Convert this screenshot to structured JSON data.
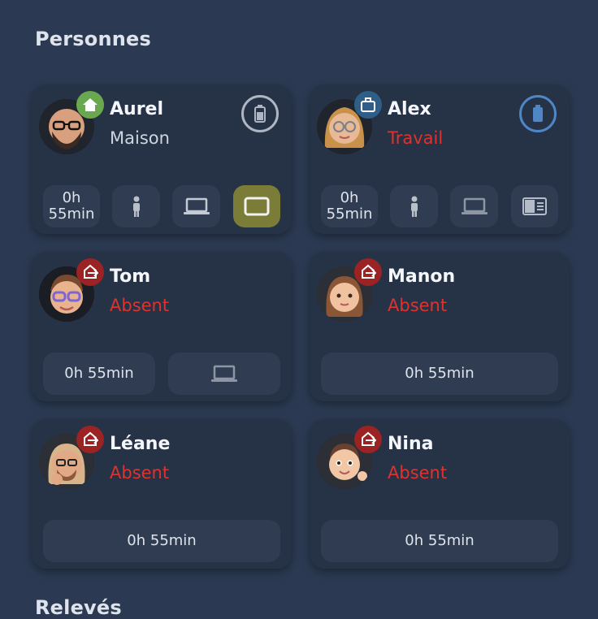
{
  "sections": {
    "people_title": "Personnes",
    "readings_title": "Relevés"
  },
  "people": [
    {
      "name": "Aurel",
      "status": "Maison",
      "status_type": "home",
      "duration_line1": "0h",
      "duration_line2": "55min"
    },
    {
      "name": "Alex",
      "status": "Travail",
      "status_type": "work",
      "duration_line1": "0h",
      "duration_line2": "55min"
    },
    {
      "name": "Tom",
      "status": "Absent",
      "status_type": "absent",
      "duration": "0h 55min"
    },
    {
      "name": "Manon",
      "status": "Absent",
      "status_type": "absent",
      "duration": "0h 55min"
    },
    {
      "name": "Léane",
      "status": "Absent",
      "status_type": "absent",
      "duration": "0h 55min"
    },
    {
      "name": "Nina",
      "status": "Absent",
      "status_type": "absent",
      "duration": "0h 55min"
    }
  ],
  "colors": {
    "background": "#2b3a52",
    "card": "#263347",
    "home_badge": "#6aa84f",
    "work_badge": "#2f5f88",
    "absent_badge": "#9b2323",
    "absent_text": "#e0322d",
    "active_device": "#7b7c37"
  },
  "icons": {
    "home": "house-icon",
    "work": "briefcase-icon",
    "absent": "leave-home-icon",
    "battery": "battery-icon",
    "person": "person-icon",
    "laptop": "laptop-icon",
    "tablet": "tablet-icon",
    "reader": "ereader-icon"
  }
}
